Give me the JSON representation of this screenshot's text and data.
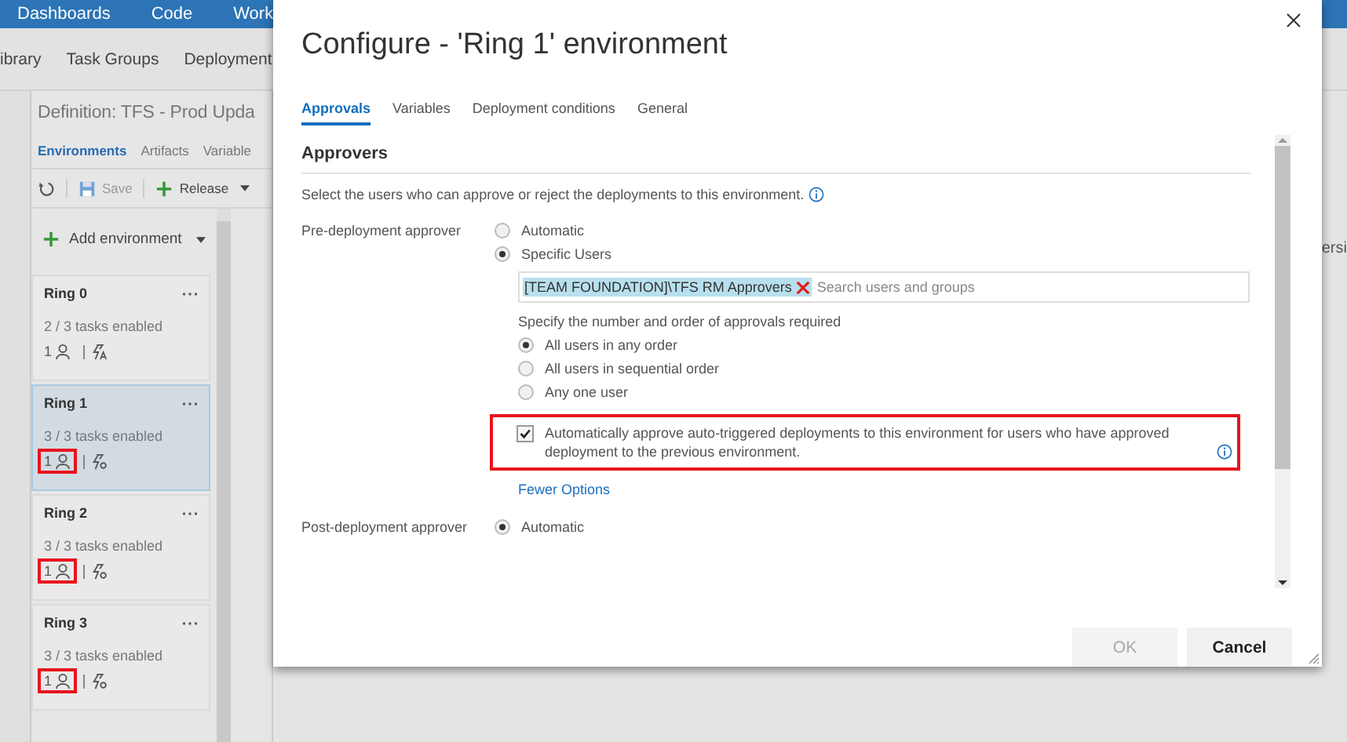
{
  "top_nav": {
    "items": [
      "Dashboards",
      "Code",
      "Work"
    ]
  },
  "sub_nav": {
    "items": [
      "ibrary",
      "Task Groups",
      "Deployment"
    ]
  },
  "definition": {
    "title": "Definition: TFS - Prod Upda",
    "tabs": [
      {
        "label": "Environments",
        "selected": true
      },
      {
        "label": "Artifacts",
        "selected": false
      },
      {
        "label": "Variable",
        "selected": false
      }
    ],
    "toolbar": [
      {
        "kind": "refresh"
      },
      {
        "kind": "save",
        "label": "Save",
        "disabled": true
      },
      {
        "kind": "release",
        "label": "Release"
      }
    ],
    "add_environment": "Add environment",
    "environments": [
      {
        "name": "Ring 0",
        "tasks": "2 / 3 tasks enabled",
        "approvers": "1",
        "kind": "manual_trigger",
        "selected": false,
        "highlighted": false
      },
      {
        "name": "Ring 1",
        "tasks": "3 / 3 tasks enabled",
        "approvers": "1",
        "kind": "auto_trigger",
        "selected": true,
        "highlighted": true
      },
      {
        "name": "Ring 2",
        "tasks": "3 / 3 tasks enabled",
        "approvers": "1",
        "kind": "auto_trigger",
        "selected": false,
        "highlighted": true
      },
      {
        "name": "Ring 3",
        "tasks": "3 / 3 tasks enabled",
        "approvers": "1",
        "kind": "auto_trigger",
        "selected": false,
        "highlighted": true
      }
    ]
  },
  "right_edge_text": "ersi",
  "dialog": {
    "title": "Configure - 'Ring 1' environment",
    "tabs": [
      {
        "label": "Approvals",
        "selected": true
      },
      {
        "label": "Variables",
        "selected": false
      },
      {
        "label": "Deployment conditions",
        "selected": false
      },
      {
        "label": "General",
        "selected": false
      }
    ],
    "section": "Approvers",
    "description": "Select the users who can approve or reject the deployments to this environment.",
    "pre_deployment": {
      "label": "Pre-deployment approver",
      "options": [
        {
          "label": "Automatic",
          "selected": false
        },
        {
          "label": "Specific Users",
          "selected": true
        }
      ],
      "approver_tag": "[TEAM FOUNDATION]\\TFS RM Approvers",
      "search_placeholder": "Search users and groups",
      "order_label": "Specify the number and order of approvals required",
      "order_options": [
        {
          "label": "All users in any order",
          "selected": true
        },
        {
          "label": "All users in sequential order",
          "selected": false
        },
        {
          "label": "Any one user",
          "selected": false
        }
      ],
      "auto_approve": {
        "label": "Automatically approve auto-triggered deployments to this environment for users who have approved deployment to the previous environment.",
        "checked": true,
        "highlighted": true
      },
      "fewer_options": "Fewer Options"
    },
    "post_deployment": {
      "label": "Post-deployment approver",
      "options": [
        {
          "label": "Automatic",
          "selected": true
        }
      ]
    },
    "buttons": [
      {
        "label": "OK",
        "disabled": true,
        "primary": false
      },
      {
        "label": "Cancel",
        "disabled": false,
        "primary": true
      }
    ]
  }
}
